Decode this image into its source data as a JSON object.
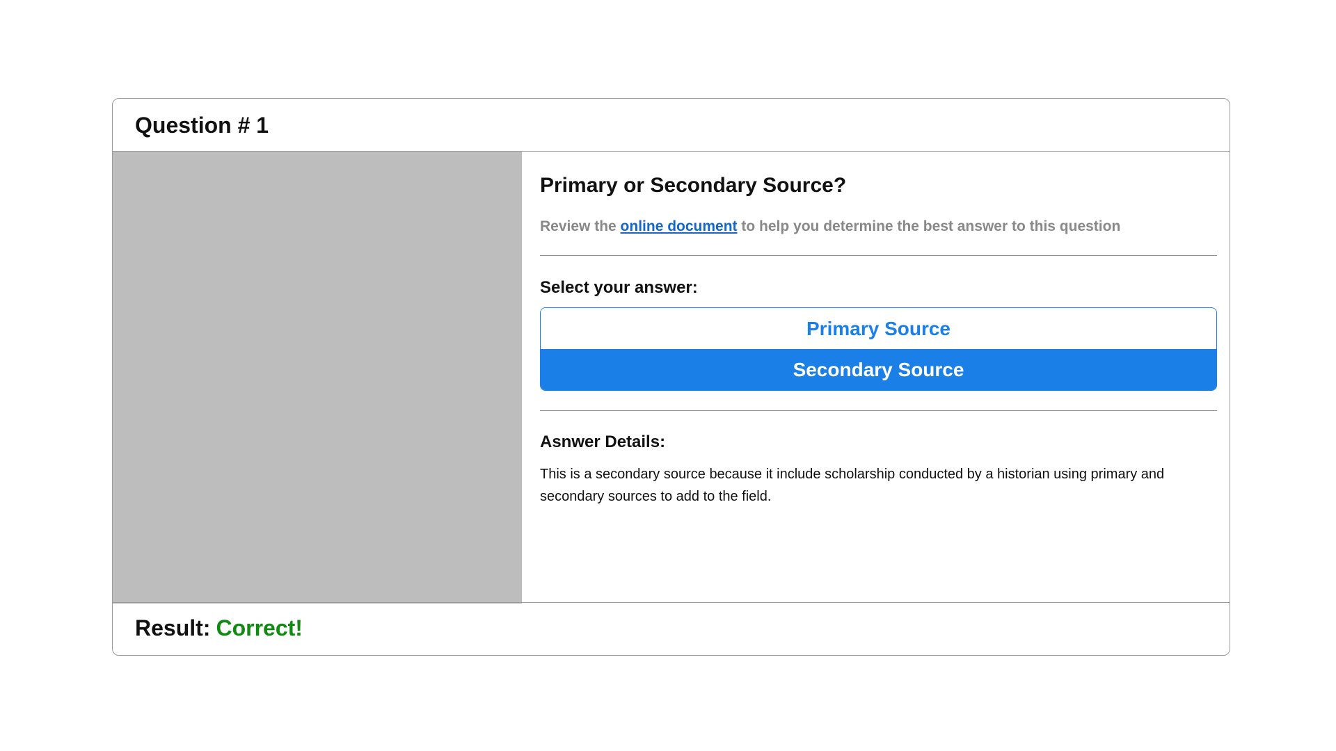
{
  "header": {
    "title": "Question # 1"
  },
  "question": {
    "heading": "Primary or Secondary Source?",
    "instructions_before": "Review the ",
    "instructions_link": "online document",
    "instructions_after": " to help you determine the best answer to this question"
  },
  "answer": {
    "label": "Select your answer:",
    "options": [
      {
        "label": "Primary Source",
        "selected": false
      },
      {
        "label": "Secondary Source",
        "selected": true
      }
    ]
  },
  "details": {
    "label": "Asnwer Details:",
    "text": "This is a secondary source because it include scholarship conducted by a historian using primary and secondary sources to add to the field."
  },
  "footer": {
    "result_label": "Result:",
    "result_value": "Correct!"
  },
  "colors": {
    "accent": "#1a7fe6",
    "link": "#1466c9",
    "success": "#118a11",
    "image_placeholder": "#bdbdbd"
  }
}
